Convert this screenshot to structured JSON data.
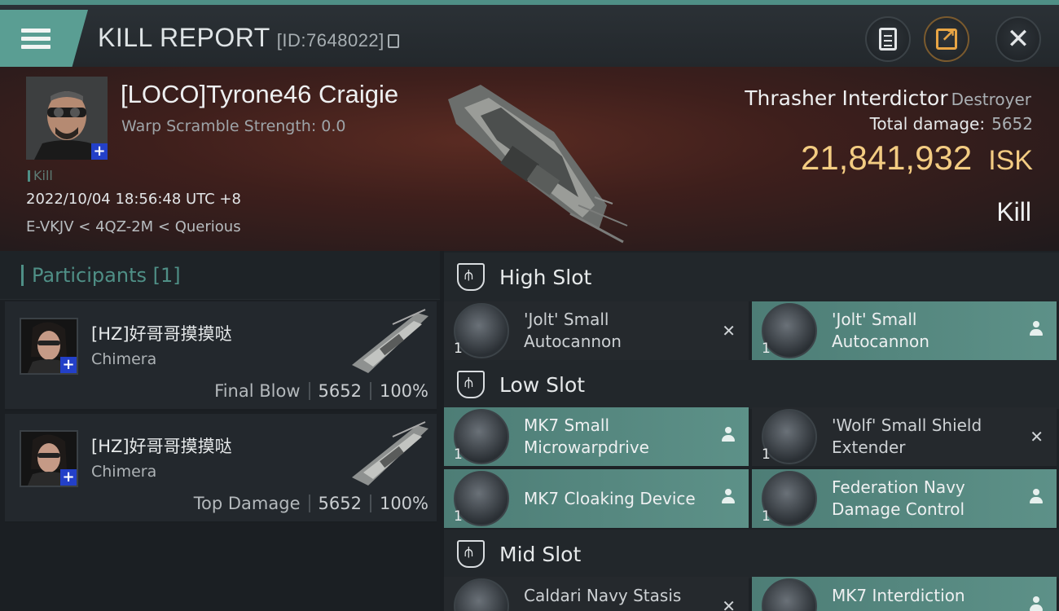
{
  "header": {
    "title": "KILL REPORT",
    "report_id": "[ID:7648022]"
  },
  "victim": {
    "name": "[LOCO]Tyrone46 Craigie",
    "warp_scramble": "Warp Scramble Strength: 0.0",
    "kill_tag": "Kill",
    "datetime": "2022/10/04 18:56:48 UTC +8",
    "location": "E-VKJV < 4QZ-2M < Querious",
    "ship_name": "Thrasher Interdictor",
    "ship_class": "Destroyer",
    "total_damage_label": "Total damage:",
    "total_damage": "5652",
    "isk_value": "21,841,932",
    "isk_unit": "ISK",
    "result": "Kill"
  },
  "participants": {
    "title": "Participants",
    "count": "[1]",
    "rows": [
      {
        "name": "[HZ]好哥哥摸摸哒",
        "ship": "Chimera",
        "role": "Final Blow",
        "damage": "5652",
        "percent": "100%"
      },
      {
        "name": "[HZ]好哥哥摸摸哒",
        "ship": "Chimera",
        "role": "Top Damage",
        "damage": "5652",
        "percent": "100%"
      }
    ]
  },
  "slots": {
    "high": {
      "label": "High Slot",
      "modules": [
        {
          "line1": "'Jolt' Small",
          "line2": "Autocannon",
          "qty": "1",
          "status": "dropped"
        },
        {
          "line1": "'Jolt' Small",
          "line2": "Autocannon",
          "qty": "1",
          "status": "fitted"
        }
      ]
    },
    "low": {
      "label": "Low Slot",
      "modules": [
        {
          "line1": "MK7 Small",
          "line2": "Microwarpdrive",
          "qty": "1",
          "status": "fitted"
        },
        {
          "line1": "'Wolf' Small Shield",
          "line2": "Extender",
          "qty": "1",
          "status": "dropped"
        },
        {
          "line1": "MK7 Cloaking Device",
          "line2": "",
          "qty": "1",
          "status": "fitted"
        },
        {
          "line1": "Federation Navy",
          "line2": "Damage Control",
          "qty": "1",
          "status": "fitted"
        }
      ]
    },
    "mid": {
      "label": "Mid Slot",
      "modules": [
        {
          "line1": "Caldari Navy Stasis",
          "line2": "",
          "qty": "",
          "status": "dropped"
        },
        {
          "line1": "MK7 Interdiction",
          "line2": "",
          "qty": "",
          "status": "fitted"
        }
      ]
    }
  },
  "colors": {
    "accent": "#4f8f86",
    "isk": "#f3cc82",
    "fitted": "#5d9188"
  }
}
